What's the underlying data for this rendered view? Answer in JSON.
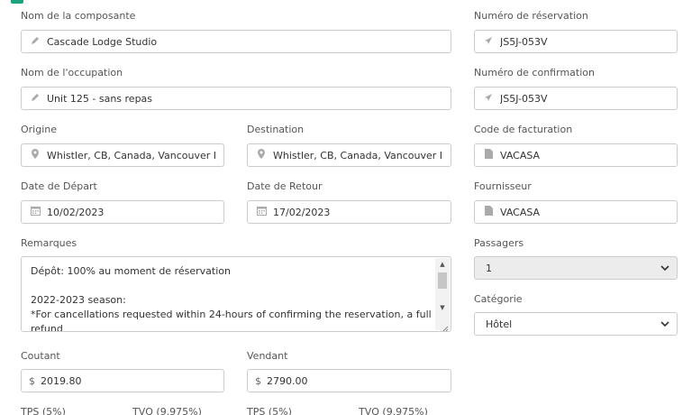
{
  "form": {
    "composante": {
      "label": "Nom de la composante",
      "value": "Cascade Lodge Studio"
    },
    "reservation": {
      "label": "Numéro de réservation",
      "value": "JS5J-053V"
    },
    "occupation": {
      "label": "Nom de l'occupation",
      "value": "Unit 125 - sans repas"
    },
    "confirmation": {
      "label": "Numéro de confirmation",
      "value": "JS5J-053V"
    },
    "origine": {
      "label": "Origine",
      "value": "Whistler, CB, Canada, Vancouver Inte"
    },
    "destination": {
      "label": "Destination",
      "value": "Whistler, CB, Canada, Vancouver Inte"
    },
    "facturation": {
      "label": "Code de facturation",
      "value": "VACASA"
    },
    "depart": {
      "label": "Date de Départ",
      "value": "10/02/2023"
    },
    "retour": {
      "label": "Date de Retour",
      "value": "17/02/2023"
    },
    "fournisseur": {
      "label": "Fournisseur",
      "value": "VACASA"
    },
    "remarques": {
      "label": "Remarques",
      "line1": "Dépôt: 100% au moment de réservation",
      "line2": "2022-2023 season:",
      "line3": "*For cancellations requested within 24-hours of confirming the reservation, a full",
      "line4": "refund"
    },
    "passagers": {
      "label": "Passagers",
      "value": "1"
    },
    "categorie": {
      "label": "Catégorie",
      "value": "Hôtel"
    },
    "coutant": {
      "label": "Coutant",
      "currency": "$",
      "value": "2019.80"
    },
    "vendant": {
      "label": "Vendant",
      "currency": "$",
      "value": "2790.00"
    },
    "taxes": {
      "tps1": "TPS (5%)",
      "tvq1": "TVQ (9.975%)",
      "tps2": "TPS (5%)",
      "tvq2": "TVQ (9.975%)"
    }
  },
  "icons": {
    "pencil": "pencil-icon",
    "send": "send-icon",
    "pin": "map-pin-icon",
    "file": "file-icon",
    "calendar": "calendar-icon",
    "chevron": "chevron-down-icon"
  },
  "colors": {
    "accent": "#1ba37d",
    "border": "#cccccc",
    "label": "#555555",
    "select_bg": "#ececec"
  }
}
